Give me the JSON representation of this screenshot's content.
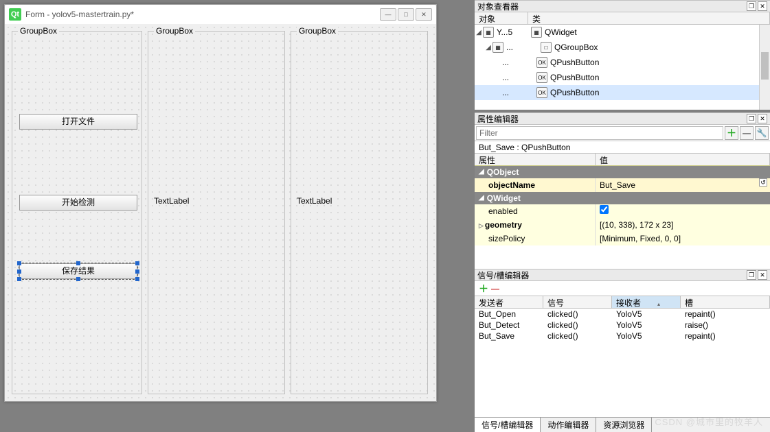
{
  "form": {
    "title": "Form - yolov5-mastertrain.py*",
    "groupbox_label": "GroupBox",
    "text_label": "TextLabel",
    "buttons": {
      "open": "打开文件",
      "detect": "开始检测",
      "save": "保存结果"
    }
  },
  "object_inspector": {
    "title": "对象查看器",
    "columns": {
      "object": "对象",
      "class": "类"
    },
    "rows": [
      {
        "name": "Y...5",
        "class": "QWidget",
        "depth": 0,
        "expanded": true
      },
      {
        "name": "...",
        "class": "QGroupBox",
        "depth": 1,
        "expanded": true
      },
      {
        "name": "...",
        "class": "QPushButton",
        "depth": 2
      },
      {
        "name": "...",
        "class": "QPushButton",
        "depth": 2
      },
      {
        "name": "...",
        "class": "QPushButton",
        "depth": 2,
        "selected": true
      }
    ]
  },
  "property_editor": {
    "title": "属性编辑器",
    "filter_placeholder": "Filter",
    "object_line": "But_Save : QPushButton",
    "columns": {
      "prop": "属性",
      "value": "值"
    },
    "sections": {
      "qobject": "QObject",
      "qwidget": "QWidget"
    },
    "props": {
      "objectName_label": "objectName",
      "objectName_value": "But_Save",
      "enabled_label": "enabled",
      "enabled_checked": true,
      "geometry_label": "geometry",
      "geometry_value": "[(10, 338), 172 x 23]",
      "sizePolicy_label": "sizePolicy",
      "sizePolicy_value": "[Minimum, Fixed, 0, 0]"
    }
  },
  "signal_editor": {
    "title": "信号/槽编辑器",
    "columns": {
      "sender": "发送者",
      "signal": "信号",
      "receiver": "接收者",
      "slot": "槽"
    },
    "rows": [
      {
        "sender": "But_Open",
        "signal": "clicked()",
        "receiver": "YoloV5",
        "slot": "repaint()"
      },
      {
        "sender": "But_Detect",
        "signal": "clicked()",
        "receiver": "YoloV5",
        "slot": "raise()"
      },
      {
        "sender": "But_Save",
        "signal": "clicked()",
        "receiver": "YoloV5",
        "slot": "repaint()"
      }
    ]
  },
  "bottom_tabs": {
    "signal": "信号/槽编辑器",
    "action": "动作编辑器",
    "resource": "资源浏览器"
  },
  "watermark": "CSDN @城市里的牧羊人"
}
